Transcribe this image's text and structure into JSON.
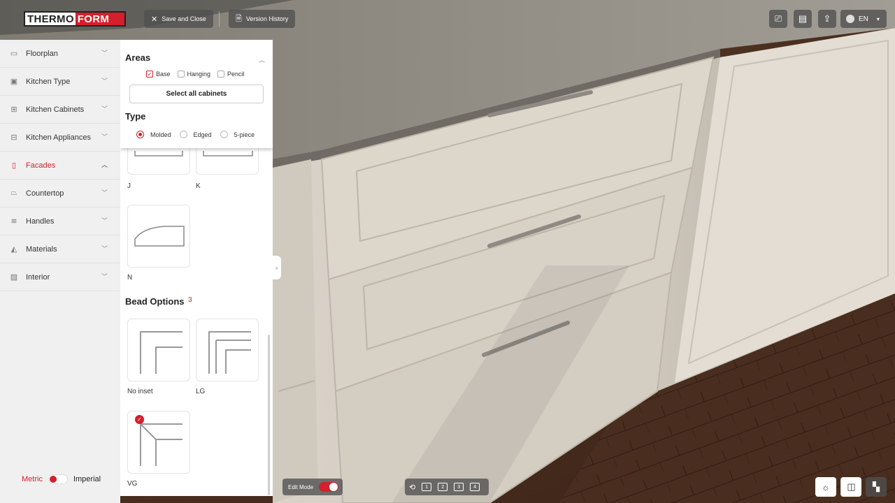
{
  "brand": {
    "logo_left": "THERMO",
    "logo_right": "FORM"
  },
  "toolbar": {
    "save_close": "Save and Close",
    "version_history": "Version History",
    "language": "EN"
  },
  "sidebar": {
    "items": [
      {
        "label": "Floorplan",
        "icon": "floorplan-icon"
      },
      {
        "label": "Kitchen Type",
        "icon": "kitchen-type-icon"
      },
      {
        "label": "Kitchen Cabinets",
        "icon": "cabinets-icon"
      },
      {
        "label": "Kitchen Appliances",
        "icon": "appliances-icon"
      },
      {
        "label": "Facades",
        "icon": "facades-icon",
        "active": true
      },
      {
        "label": "Countertop",
        "icon": "countertop-icon"
      },
      {
        "label": "Handles",
        "icon": "handles-icon"
      },
      {
        "label": "Materials",
        "icon": "materials-icon"
      },
      {
        "label": "Interior",
        "icon": "interior-icon"
      }
    ],
    "units": {
      "metric": "Metric",
      "imperial": "Imperial",
      "selected": "Metric"
    }
  },
  "panel": {
    "areas": {
      "title": "Areas",
      "options": [
        {
          "label": "Base",
          "checked": true
        },
        {
          "label": "Hanging",
          "checked": false
        },
        {
          "label": "Pencil",
          "checked": false
        }
      ],
      "select_all": "Select all cabinets"
    },
    "type": {
      "title": "Type",
      "options": [
        {
          "label": "Molded",
          "selected": true
        },
        {
          "label": "Edged",
          "selected": false
        },
        {
          "label": "5-piece",
          "selected": false
        }
      ]
    },
    "profiles": [
      "J",
      "K",
      "N"
    ],
    "bead_options": {
      "title": "Bead Options",
      "count": "3",
      "items": [
        {
          "label": "No inset",
          "selected": false
        },
        {
          "label": "LG",
          "selected": false
        },
        {
          "label": "VG",
          "selected": true
        }
      ]
    }
  },
  "bottom": {
    "edit_mode": "Edit Mode",
    "edit_mode_on": true,
    "views": [
      "1",
      "2",
      "3",
      "4"
    ]
  },
  "colors": {
    "accent": "#d41f2c",
    "panel": "#ffffff",
    "sidebar": "#f0f0f0"
  }
}
